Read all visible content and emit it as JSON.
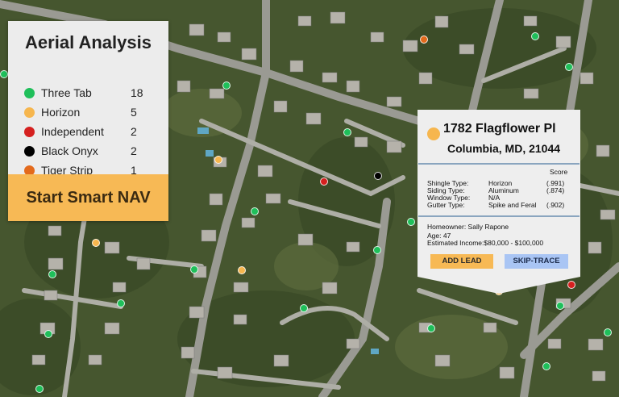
{
  "legend": {
    "title": "Aerial Analysis",
    "items": [
      {
        "label": "Three Tab",
        "count": "18",
        "color": "#1fbf5a"
      },
      {
        "label": "Horizon",
        "count": "5",
        "color": "#f6b64e"
      },
      {
        "label": "Independent",
        "count": "2",
        "color": "#d5201f"
      },
      {
        "label": "Black Onyx",
        "count": "2",
        "color": "#000000"
      },
      {
        "label": "Tiger Strip",
        "count": "1",
        "color": "#e36a1c"
      }
    ],
    "start_button": "Start Smart NAV"
  },
  "popup": {
    "address_line1": "1782 Flagflower Pl",
    "address_line2": "Columbia, MD, 21044",
    "dot_color": "#f6b64e",
    "score_header": "Score",
    "specs": [
      {
        "label": "Shingle Type:",
        "value": "Horizon",
        "score": "(.991)"
      },
      {
        "label": "Siding Type:",
        "value": "Aluminum",
        "score": "(.874)"
      },
      {
        "label": "Window Type:",
        "value": "N/A",
        "score": ""
      },
      {
        "label": "Gutter Type:",
        "value": "Spike and Feral",
        "score": "(.902)"
      }
    ],
    "homeowner": "Homeowner: Sally Rapone",
    "age": "Age: 47",
    "income": "Estimated Income:$80,000 - $100,000",
    "add_lead": "ADD LEAD",
    "skip_trace": "SKIP-TRACE"
  }
}
